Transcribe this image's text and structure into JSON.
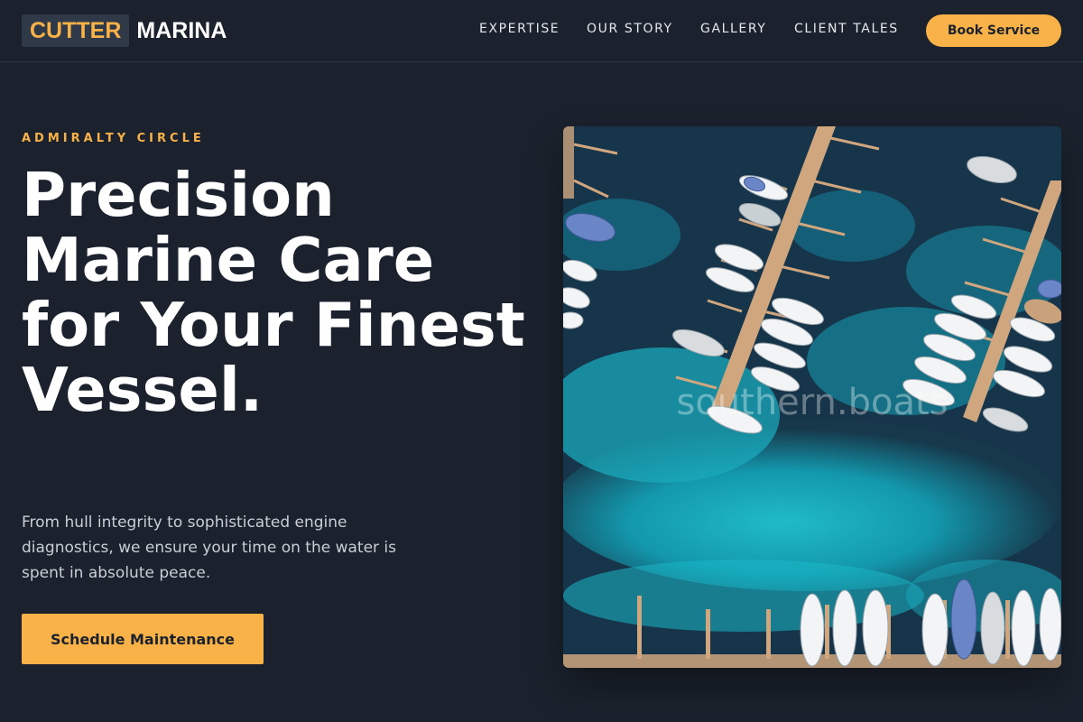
{
  "header": {
    "logo_highlight": "CUTTER",
    "logo_rest": "MARINA",
    "nav": [
      "EXPERTISE",
      "OUR STORY",
      "GALLERY",
      "CLIENT TALES"
    ],
    "book_label": "Book Service"
  },
  "hero": {
    "eyebrow": "ADMIRALTY CIRCLE",
    "headline": "Precision Marine Care for Your Finest Vessel.",
    "subtext": "From hull integrity to sophisticated engine diagnostics, we ensure your time on the water is spent in absolute peace.",
    "cta_label": "Schedule Maintenance"
  },
  "photo": {
    "watermark": "southern.boats",
    "alt": "Aerial view of a marina with boats moored along wooden piers over turquoise water"
  },
  "colors": {
    "accent": "#f9b248",
    "background": "#1b222d",
    "water_deep": "#18394a",
    "water_turquoise": "#1fb5c6"
  }
}
